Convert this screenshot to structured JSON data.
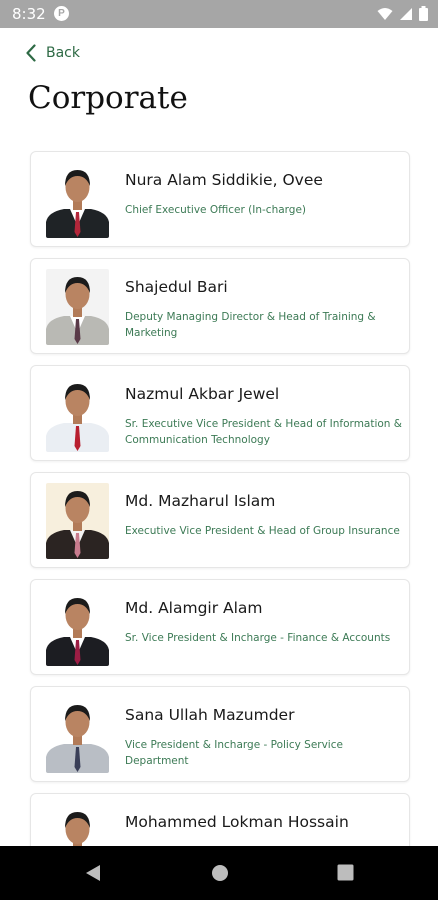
{
  "status": {
    "time": "8:32",
    "app_icon_letter": "P"
  },
  "header": {
    "back_label": "Back",
    "title": "Corporate"
  },
  "people": [
    {
      "name": "Nura Alam Siddikie, Ovee",
      "role": "Chief Executive Officer (In-charge)",
      "bg": "#ffffff",
      "suit": "#1f2326",
      "shirt": "#ffffff",
      "tie": "#b3263a"
    },
    {
      "name": "Shajedul Bari",
      "role": "Deputy Managing Director & Head of Training & Marketing",
      "bg": "#f3f3f3",
      "suit": "#b9b9b4",
      "shirt": "#ffffff",
      "tie": "#5a3a48"
    },
    {
      "name": "Nazmul Akbar Jewel",
      "role": "Sr. Executive Vice President & Head of Information & Communication Technology",
      "bg": "#ffffff",
      "suit": "#eaeef3",
      "shirt": "#eaeef3",
      "tie": "#b81f2f"
    },
    {
      "name": "Md. Mazharul Islam",
      "role": "Executive Vice President & Head of Group Insurance",
      "bg": "#f7efdd",
      "suit": "#2b2422",
      "shirt": "#f4f4f4",
      "tie": "#c97c8e"
    },
    {
      "name": "Md. Alamgir Alam",
      "role": "Sr. Vice President & Incharge - Finance & Accounts",
      "bg": "#ffffff",
      "suit": "#1c1d22",
      "shirt": "#ffffff",
      "tie": "#9c1d44"
    },
    {
      "name": "Sana Ullah Mazumder",
      "role": "Vice President & Incharge - Policy Service Department",
      "bg": "#ffffff",
      "suit": "#b9bec5",
      "shirt": "#b9bec5",
      "tie": "#3a3f58"
    },
    {
      "name": "Mohammed Lokman Hossain",
      "role": "",
      "bg": "#ffffff",
      "suit": "#1f2326",
      "shirt": "#ffffff",
      "tie": "#b3263a"
    }
  ],
  "colors": {
    "accent": "#2e6a45",
    "role_text": "#3c7a55",
    "status_bar": "#a6a6a6",
    "nav_bar": "#000000"
  },
  "icons": {
    "back": "chevron-left-icon",
    "wifi": "wifi-icon",
    "signal": "signal-icon",
    "battery": "battery-icon",
    "nav_back": "nav-back-icon",
    "nav_home": "nav-home-icon",
    "nav_recents": "nav-recents-icon"
  }
}
